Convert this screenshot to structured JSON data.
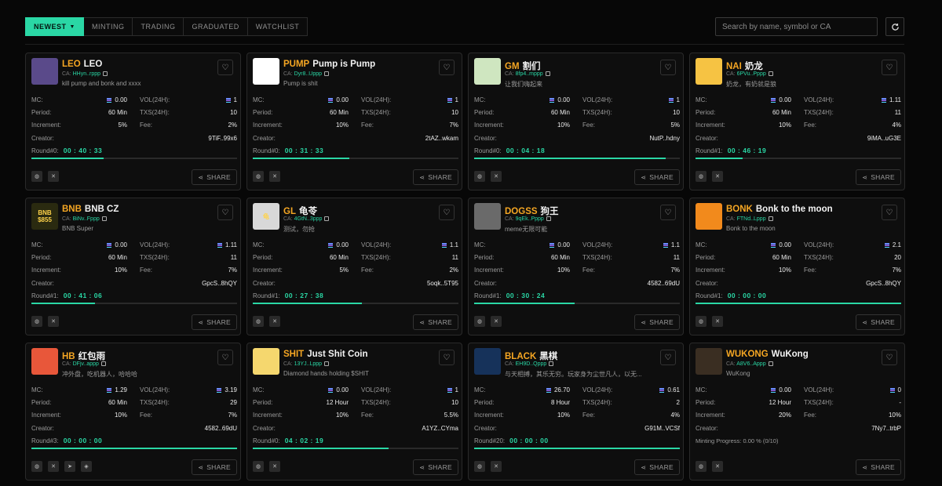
{
  "tabs": [
    {
      "label": "NEWEST",
      "active": true
    },
    {
      "label": "MINTING"
    },
    {
      "label": "TRADING"
    },
    {
      "label": "GRADUATED"
    },
    {
      "label": "WATCHLIST"
    }
  ],
  "search": {
    "placeholder": "Search by name, symbol or CA"
  },
  "labels": {
    "mc": "MC:",
    "vol": "VOL(24H):",
    "period": "Period:",
    "txs": "TXS(24H):",
    "increment": "Increment:",
    "fee": "Fee:",
    "creator": "Creator:",
    "share": "SHARE",
    "ca": "CA:"
  },
  "cards": [
    {
      "symbol": "LEO",
      "name": "LEO",
      "ca": "HHyn..rppp",
      "desc": "kill pump and bonk and xxxx",
      "mc": "0.00",
      "vol": "1",
      "period": "60 Min",
      "txs": "10",
      "increment": "5%",
      "fee": "2%",
      "creator": "9TiF..99x6",
      "round": "Round#0:",
      "timer": "00 : 40 : 33",
      "progress": 0.35,
      "logo_color": "#5a4a8a",
      "logo_text": "",
      "socials": [
        "globe-icon",
        "x-icon"
      ]
    },
    {
      "symbol": "PUMP",
      "name": "Pump is Pump",
      "ca": "Dyr8..Uppp",
      "desc": "Pump is shit",
      "mc": "0.00",
      "vol": "1",
      "period": "60 Min",
      "txs": "10",
      "increment": "10%",
      "fee": "7%",
      "creator": "2tAZ..wkam",
      "round": "Round#0:",
      "timer": "00 : 31 : 33",
      "progress": 0.47,
      "logo_color": "#ffffff",
      "logo_text": "",
      "socials": [
        "globe-icon",
        "x-icon"
      ]
    },
    {
      "symbol": "GM",
      "name": "割们",
      "ca": "8fp4..mppp",
      "desc": "让我们嗨起来",
      "mc": "0.00",
      "vol": "1",
      "period": "60 Min",
      "txs": "10",
      "increment": "10%",
      "fee": "5%",
      "creator": "NutP..hdny",
      "round": "Round#0:",
      "timer": "00 : 04 : 18",
      "progress": 0.93,
      "logo_color": "#cfe6c0",
      "logo_text": "",
      "socials": [
        "globe-icon",
        "x-icon"
      ]
    },
    {
      "symbol": "NAI",
      "name": "奶龙",
      "ca": "6PVu..Pppp",
      "desc": "奶龙，有奶就是狼",
      "mc": "0.00",
      "vol": "1.11",
      "period": "60 Min",
      "txs": "11",
      "increment": "10%",
      "fee": "4%",
      "creator": "9iMA..uG3E",
      "round": "Round#1:",
      "timer": "00 : 46 : 19",
      "progress": 0.23,
      "logo_color": "#f6c343",
      "logo_text": "",
      "socials": [
        "globe-icon",
        "x-icon"
      ]
    },
    {
      "symbol": "BNB",
      "name": "BNB CZ",
      "ca": "BiNv..Fppp",
      "desc": "BNB Super",
      "mc": "0.00",
      "vol": "1.11",
      "period": "60 Min",
      "txs": "11",
      "increment": "10%",
      "fee": "7%",
      "creator": "GpcS..8hQY",
      "round": "Round#1:",
      "timer": "00 : 41 : 06",
      "progress": 0.31,
      "logo_color": "#2a2a10",
      "logo_text": "BNB $855",
      "socials": [
        "globe-icon",
        "x-icon"
      ]
    },
    {
      "symbol": "GL",
      "name": "龟苓",
      "ca": "4GtN..3ppp",
      "desc": "测试，勿抢",
      "mc": "0.00",
      "vol": "1.1",
      "period": "60 Min",
      "txs": "11",
      "increment": "5%",
      "fee": "2%",
      "creator": "5oqk..5T95",
      "round": "Round#1:",
      "timer": "00 : 27 : 38",
      "progress": 0.53,
      "logo_color": "#d8d8d8",
      "logo_text": "龟",
      "socials": [
        "globe-icon",
        "x-icon"
      ]
    },
    {
      "symbol": "DOGSS",
      "name": "狗王",
      "ca": "9qEk..Pppp",
      "desc": "meme无限可能",
      "mc": "0.00",
      "vol": "1.1",
      "period": "60 Min",
      "txs": "11",
      "increment": "10%",
      "fee": "7%",
      "creator": "4582..69dU",
      "round": "Round#1:",
      "timer": "00 : 30 : 24",
      "progress": 0.49,
      "logo_color": "#6a6a6a",
      "logo_text": "",
      "socials": [
        "globe-icon",
        "x-icon"
      ]
    },
    {
      "symbol": "BONK",
      "name": "Bonk to the moon",
      "ca": "FTNd..Lppp",
      "desc": "Bonk to the moon",
      "mc": "0.00",
      "vol": "2.1",
      "period": "60 Min",
      "txs": "20",
      "increment": "10%",
      "fee": "7%",
      "creator": "GpcS..8hQY",
      "round": "Round#1:",
      "timer": "00 : 00 : 00",
      "progress": 1,
      "logo_color": "#f28a1c",
      "logo_text": "",
      "socials": [
        "globe-icon",
        "x-icon"
      ]
    },
    {
      "symbol": "HB",
      "name": "红包雨",
      "ca": "DFjv..appp",
      "desc": "冲外盘，吃机器人，哈哈哈",
      "mc": "1.29",
      "vol": "3.19",
      "period": "60 Min",
      "txs": "29",
      "increment": "10%",
      "fee": "7%",
      "creator": "4582..69dU",
      "round": "Round#3:",
      "timer": "00 : 00 : 00",
      "progress": 1,
      "logo_color": "#e8573a",
      "logo_text": "",
      "socials": [
        "globe-icon",
        "x-icon",
        "telegram-icon",
        "discord-icon"
      ]
    },
    {
      "symbol": "SHIT",
      "name": "Just Shit Coin",
      "ca": "13YJ..Lppp",
      "desc": "Diamond hands holding $SHIT",
      "mc": "0.00",
      "vol": "1",
      "period": "12 Hour",
      "txs": "10",
      "increment": "10%",
      "fee": "5.5%",
      "creator": "A1YZ..CYma",
      "round": "Round#0:",
      "timer": "04 : 02 : 19",
      "progress": 0.66,
      "logo_color": "#f5d76e",
      "logo_text": "",
      "socials": [
        "globe-icon",
        "x-icon"
      ]
    },
    {
      "symbol": "BLACK",
      "name": "黑棋",
      "ca": "EH9D..Qppp",
      "desc": "与天相搏，其乐无穷。玩家身为尘世凡人，以无...",
      "mc": "26.70",
      "vol": "0.61",
      "period": "8 Hour",
      "txs": "2",
      "increment": "10%",
      "fee": "4%",
      "creator": "G91M..VCSf",
      "round": "Round#20:",
      "timer": "00 : 00 : 00",
      "progress": 1,
      "logo_color": "#16325a",
      "logo_text": "",
      "socials": [
        "globe-icon",
        "x-icon"
      ]
    },
    {
      "symbol": "WUKONG",
      "name": "WuKong",
      "ca": "A8V6..Appp",
      "desc": "WuKong",
      "mc": "0.00",
      "vol": "0",
      "period": "12 Hour",
      "txs": "-",
      "increment": "20%",
      "fee": "10%",
      "creator": "7Ny7..trbP",
      "minting": "Minting Progress: 0.00 % (0/10)",
      "logo_color": "#3a2e22",
      "logo_text": "",
      "socials": [
        "globe-icon",
        "x-icon"
      ]
    }
  ]
}
